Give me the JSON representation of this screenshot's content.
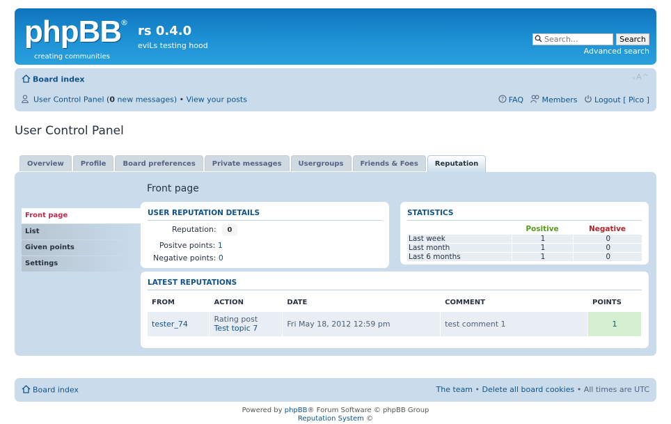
{
  "header": {
    "logo_text": "phpBB",
    "logo_reg": "®",
    "logo_tagline": "creating communities",
    "site_title": "rs 0.4.0",
    "site_description": "eviLs testing hood",
    "search_placeholder": "Search…",
    "search_button": "Search",
    "advanced_search": "Advanced search"
  },
  "navbar": {
    "board_index": "Board index",
    "font_size": "ᵥA^",
    "ucp_label": "User Control Panel",
    "ucp_count_open": " (",
    "ucp_count": "0",
    "ucp_count_close": " new messages)",
    "separator": " • ",
    "view_posts": "View your posts",
    "faq": "FAQ",
    "members": "Members",
    "logout": "Logout [ Pico ]"
  },
  "page_title": "User Control Panel",
  "tabs": [
    {
      "label": "Overview"
    },
    {
      "label": "Profile"
    },
    {
      "label": "Board preferences"
    },
    {
      "label": "Private messages"
    },
    {
      "label": "Usergroups"
    },
    {
      "label": "Friends & Foes"
    },
    {
      "label": "Reputation"
    }
  ],
  "sidebar": {
    "items": [
      {
        "label": "Front page"
      },
      {
        "label": "List"
      },
      {
        "label": "Given points"
      },
      {
        "label": "Settings"
      }
    ]
  },
  "main": {
    "heading": "Front page",
    "user_rep": {
      "title": "USER REPUTATION DETAILS",
      "reputation_label": "Reputation:",
      "reputation_value": "0",
      "positive_label": "Positve points:",
      "positive_value": "1",
      "negative_label": "Negative points:",
      "negative_value": "0"
    },
    "stats": {
      "title": "STATISTICS",
      "col_positive": "Positive",
      "col_negative": "Negative",
      "rows": [
        {
          "period": "Last week",
          "positive": "1",
          "negative": "0"
        },
        {
          "period": "Last month",
          "positive": "1",
          "negative": "0"
        },
        {
          "period": "Last 6 months",
          "positive": "1",
          "negative": "0"
        }
      ],
      "positive_color": "#5a9a1e",
      "negative_color": "#b0242a"
    },
    "latest": {
      "title": "LATEST REPUTATIONS",
      "headers": {
        "from": "FROM",
        "action": "ACTION",
        "date": "DATE",
        "comment": "COMMENT",
        "points": "POINTS"
      },
      "rows": [
        {
          "from": "tester_74",
          "action_type": "Rating post",
          "action_link": "Test topic 7",
          "date": "Fri May 18, 2012 12:59 pm",
          "comment": "test comment 1",
          "points": "1"
        }
      ]
    }
  },
  "footer": {
    "board_index": "Board index",
    "team": "The team",
    "delete_cookies": "Delete all board cookies",
    "times": "All times are UTC",
    "sep": " • ",
    "powered_prefix": "Powered by ",
    "powered_link": "phpBB",
    "powered_suffix": "® Forum Software © phpBB Group",
    "rep_system": "Reputation System",
    "rep_system_suffix": " ©"
  }
}
